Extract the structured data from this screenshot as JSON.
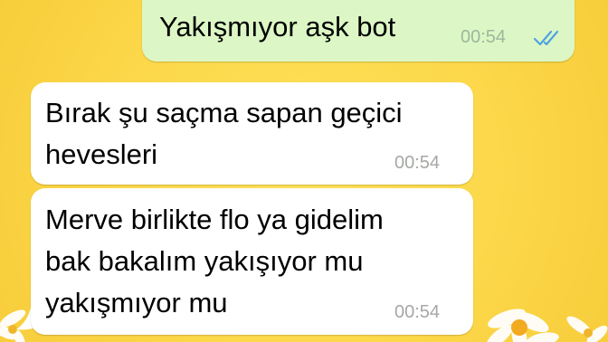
{
  "conversation": {
    "messages": [
      {
        "direction": "outgoing",
        "lines": [
          "Yakışmıyor aşk bot"
        ],
        "time": "00:54",
        "status_icon": "double-check-read-icon"
      },
      {
        "direction": "incoming",
        "lines": [
          "Bırak şu saçma sapan geçici",
          "hevesleri"
        ],
        "time": "00:54"
      },
      {
        "direction": "incoming",
        "lines": [
          "Merve birlikte flo ya gidelim",
          "bak bakalım yakışıyor mu",
          "yakışmıyor mu"
        ],
        "time": "00:54"
      }
    ]
  },
  "theme": {
    "wallpaper_color": "#fcd84a",
    "outgoing_bubble_color": "#dcf7c5",
    "incoming_bubble_color": "#ffffff",
    "read_tick_color": "#4fa3e0",
    "timestamp_color": "#a5a8a4"
  }
}
